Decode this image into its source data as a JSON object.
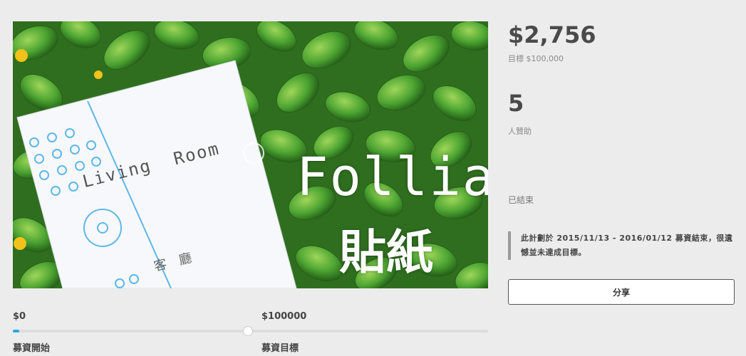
{
  "campaign": {
    "image_title": "Follia",
    "image_subtitle": "貼紙",
    "image_card_text": "Living  Room",
    "image_card_cjk": "客廳"
  },
  "funding": {
    "amount": "$2,756",
    "goal_text": "目標 $100,000",
    "backers": "5",
    "backers_label": "人贊助",
    "status": "已結束",
    "notice": "此計劃於 2015/11/13 - 2016/01/12 募資結束，很遺憾並未達成目標。",
    "share_label": "分享"
  },
  "progress": {
    "start_value": "$0",
    "goal_value": "$100000",
    "start_label": "募資開始",
    "goal_label": "募資目標",
    "fraction_of_goal": 0.02756
  },
  "colors": {
    "accent": "#27a9e1",
    "leaf": "#3f8f2b"
  }
}
